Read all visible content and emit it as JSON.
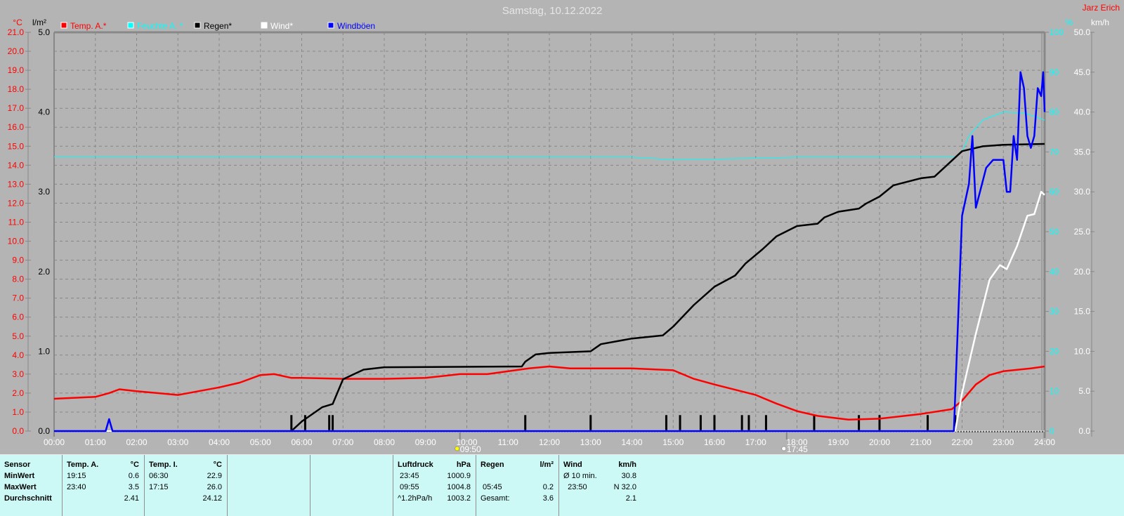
{
  "title": "Samstag, 10.12.2022",
  "author": "Jarz Erich",
  "colors": {
    "background": "#b4b4b4",
    "temp": "#ff0000",
    "humidity": "#00ffff",
    "rain": "#000000",
    "wind": "#ffffff",
    "gusts": "#0000ff",
    "table_bg": "#ccf9f6"
  },
  "markers": [
    {
      "time": "09:50",
      "label": "09:50",
      "icon": "sunrise-icon"
    },
    {
      "time": "17:45",
      "label": "17:45",
      "icon": "sunset-icon"
    }
  ],
  "chart_data": {
    "type": "line",
    "title": "Samstag, 10.12.2022",
    "grid": true,
    "legend_position": "top-left",
    "x_ticks": [
      "00:00",
      "01:00",
      "02:00",
      "03:00",
      "04:00",
      "05:00",
      "06:00",
      "07:00",
      "08:00",
      "09:00",
      "10:00",
      "11:00",
      "12:00",
      "13:00",
      "14:00",
      "15:00",
      "16:00",
      "17:00",
      "18:00",
      "19:00",
      "20:00",
      "21:00",
      "22:00",
      "23:00",
      "24:00"
    ],
    "axes": {
      "temp": {
        "unit": "°C",
        "range": [
          0,
          21
        ],
        "ticks": [
          "0.0",
          "1.0",
          "2.0",
          "3.0",
          "4.0",
          "5.0",
          "6.0",
          "7.0",
          "8.0",
          "9.0",
          "10.0",
          "11.0",
          "12.0",
          "13.0",
          "14.0",
          "15.0",
          "16.0",
          "17.0",
          "18.0",
          "19.0",
          "20.0",
          "21.0"
        ]
      },
      "rain": {
        "unit": "l/m²",
        "range": [
          0,
          5
        ],
        "ticks": [
          "0.0",
          "1.0",
          "2.0",
          "3.0",
          "4.0",
          "5.0"
        ]
      },
      "humidity": {
        "unit": "%",
        "range": [
          0,
          100
        ],
        "ticks": [
          "0",
          "10",
          "20",
          "30",
          "40",
          "50",
          "60",
          "70",
          "80",
          "90",
          "100"
        ]
      },
      "wind": {
        "unit": "km/h",
        "range": [
          0,
          50
        ],
        "ticks": [
          "0.0",
          "5.0",
          "10.0",
          "15.0",
          "20.0",
          "25.0",
          "30.0",
          "35.0",
          "40.0",
          "45.0",
          "50.0"
        ]
      }
    },
    "series": [
      {
        "name": "Temp. A.*",
        "axis": "temp",
        "color": "#ff0000",
        "points": [
          [
            "00:00",
            1.7
          ],
          [
            "01:00",
            1.8
          ],
          [
            "01:20",
            2.0
          ],
          [
            "01:35",
            2.2
          ],
          [
            "02:00",
            2.1
          ],
          [
            "02:30",
            2.0
          ],
          [
            "03:00",
            1.9
          ],
          [
            "04:00",
            2.3
          ],
          [
            "04:30",
            2.55
          ],
          [
            "05:00",
            2.95
          ],
          [
            "05:20",
            3.0
          ],
          [
            "05:45",
            2.8
          ],
          [
            "06:00",
            2.8
          ],
          [
            "07:00",
            2.75
          ],
          [
            "08:00",
            2.75
          ],
          [
            "09:00",
            2.8
          ],
          [
            "09:50",
            3.0
          ],
          [
            "10:30",
            3.0
          ],
          [
            "11:30",
            3.3
          ],
          [
            "12:00",
            3.4
          ],
          [
            "12:30",
            3.3
          ],
          [
            "14:00",
            3.3
          ],
          [
            "15:00",
            3.2
          ],
          [
            "15:30",
            2.75
          ],
          [
            "16:00",
            2.45
          ],
          [
            "17:00",
            1.9
          ],
          [
            "17:30",
            1.45
          ],
          [
            "18:00",
            1.05
          ],
          [
            "18:30",
            0.8
          ],
          [
            "19:15",
            0.6
          ],
          [
            "20:00",
            0.65
          ],
          [
            "21:00",
            0.9
          ],
          [
            "21:45",
            1.15
          ],
          [
            "22:00",
            1.6
          ],
          [
            "22:20",
            2.45
          ],
          [
            "22:40",
            2.95
          ],
          [
            "23:00",
            3.15
          ],
          [
            "23:40",
            3.3
          ],
          [
            "24:00",
            3.4
          ]
        ]
      },
      {
        "name": "Feuchte A. *",
        "axis": "humidity",
        "color": "#00ffff",
        "points": [
          [
            "00:00",
            68.7
          ],
          [
            "14:00",
            68.7
          ],
          [
            "15:00",
            68.0
          ],
          [
            "17:00",
            68.4
          ],
          [
            "18:00",
            68.7
          ],
          [
            "21:50",
            68.7
          ],
          [
            "22:00",
            70
          ],
          [
            "22:10",
            74
          ],
          [
            "22:30",
            78
          ],
          [
            "23:00",
            80
          ],
          [
            "23:30",
            79.8
          ],
          [
            "24:00",
            78
          ]
        ]
      },
      {
        "name": "Regen*",
        "axis": "rain",
        "color": "#000000",
        "points": [
          [
            "00:00",
            0
          ],
          [
            "05:45",
            0
          ],
          [
            "06:00",
            0.12
          ],
          [
            "06:30",
            0.3
          ],
          [
            "06:45",
            0.34
          ],
          [
            "07:00",
            0.65
          ],
          [
            "07:30",
            0.77
          ],
          [
            "08:00",
            0.8
          ],
          [
            "11:20",
            0.81
          ],
          [
            "11:25",
            0.87
          ],
          [
            "11:40",
            0.96
          ],
          [
            "12:00",
            0.98
          ],
          [
            "13:00",
            1.0
          ],
          [
            "13:15",
            1.09
          ],
          [
            "14:00",
            1.16
          ],
          [
            "14:45",
            1.2
          ],
          [
            "15:00",
            1.31
          ],
          [
            "15:30",
            1.58
          ],
          [
            "16:00",
            1.81
          ],
          [
            "16:30",
            1.95
          ],
          [
            "16:45",
            2.1
          ],
          [
            "17:10",
            2.28
          ],
          [
            "17:30",
            2.44
          ],
          [
            "18:00",
            2.57
          ],
          [
            "18:30",
            2.6
          ],
          [
            "18:40",
            2.68
          ],
          [
            "19:00",
            2.75
          ],
          [
            "19:30",
            2.79
          ],
          [
            "19:40",
            2.85
          ],
          [
            "20:00",
            2.94
          ],
          [
            "20:20",
            3.08
          ],
          [
            "21:00",
            3.17
          ],
          [
            "21:20",
            3.19
          ],
          [
            "21:40",
            3.35
          ],
          [
            "22:00",
            3.51
          ],
          [
            "22:30",
            3.57
          ],
          [
            "23:00",
            3.59
          ],
          [
            "24:00",
            3.6
          ]
        ]
      },
      {
        "name": "Wind*",
        "axis": "wind",
        "color": "#ffffff",
        "points": [
          [
            "00:00",
            0
          ],
          [
            "21:50",
            0
          ],
          [
            "22:00",
            4.8
          ],
          [
            "22:20",
            12.2
          ],
          [
            "22:40",
            19
          ],
          [
            "22:55",
            20.8
          ],
          [
            "23:05",
            20.3
          ],
          [
            "23:20",
            23.2
          ],
          [
            "23:35",
            27
          ],
          [
            "23:45",
            27.2
          ],
          [
            "23:55",
            30
          ],
          [
            "24:00",
            29.6
          ]
        ]
      },
      {
        "name": "Windböen",
        "axis": "wind",
        "color": "#0000ff",
        "points": [
          [
            "00:00",
            0
          ],
          [
            "01:15",
            0
          ],
          [
            "01:20",
            1.5
          ],
          [
            "01:25",
            0
          ],
          [
            "21:48",
            0
          ],
          [
            "22:00",
            27
          ],
          [
            "22:10",
            31
          ],
          [
            "22:15",
            37
          ],
          [
            "22:20",
            28
          ],
          [
            "22:35",
            33
          ],
          [
            "22:45",
            34
          ],
          [
            "23:00",
            34
          ],
          [
            "23:05",
            30
          ],
          [
            "23:10",
            30
          ],
          [
            "23:15",
            37
          ],
          [
            "23:20",
            34
          ],
          [
            "23:25",
            45
          ],
          [
            "23:30",
            43
          ],
          [
            "23:35",
            37
          ],
          [
            "23:40",
            35.5
          ],
          [
            "23:45",
            37
          ],
          [
            "23:50",
            43
          ],
          [
            "23:55",
            42
          ],
          [
            "23:58",
            45
          ],
          [
            "24:00",
            40
          ]
        ]
      }
    ],
    "rain_bars": {
      "axis": "rain",
      "color": "#000000",
      "bars": [
        [
          "05:45",
          0.2
        ],
        [
          "06:05",
          0.2
        ],
        [
          "06:40",
          0.2
        ],
        [
          "06:45",
          0.2
        ],
        [
          "11:25",
          0.2
        ],
        [
          "13:00",
          0.2
        ],
        [
          "14:50",
          0.2
        ],
        [
          "15:10",
          0.2
        ],
        [
          "15:40",
          0.2
        ],
        [
          "16:00",
          0.2
        ],
        [
          "16:40",
          0.2
        ],
        [
          "16:50",
          0.2
        ],
        [
          "17:15",
          0.2
        ],
        [
          "18:25",
          0.2
        ],
        [
          "19:30",
          0.2
        ],
        [
          "20:00",
          0.2
        ],
        [
          "21:10",
          0.2
        ],
        [
          "21:50",
          0.2
        ]
      ]
    }
  },
  "table": {
    "columns": [
      {
        "rows": [
          [
            "Sensor",
            ""
          ],
          [
            "MinWert",
            ""
          ],
          [
            "MaxWert",
            ""
          ],
          [
            "Durchschnitt",
            ""
          ]
        ]
      },
      {
        "rows": [
          [
            "Temp. A.",
            "°C"
          ],
          [
            "19:15",
            "0.6"
          ],
          [
            "23:40",
            "3.5"
          ],
          [
            "",
            "2.41"
          ]
        ]
      },
      {
        "rows": [
          [
            "Temp. I.",
            "°C"
          ],
          [
            "06:30",
            "22.9"
          ],
          [
            "17:15",
            "26.0"
          ],
          [
            "",
            "24.12"
          ]
        ]
      },
      {
        "rows": []
      },
      {
        "rows": []
      },
      {
        "rows": [
          [
            "Luftdruck",
            "hPa"
          ],
          [
            " 23:45",
            "1000.9"
          ],
          [
            " 09:55",
            "1004.8"
          ],
          [
            "^1.2hPa/h",
            "1003.2"
          ]
        ]
      },
      {
        "rows": [
          [
            "Regen",
            "l/m²"
          ],
          [
            "",
            ""
          ],
          [
            " 05:45",
            "0.2"
          ],
          [
            "Gesamt:",
            "3.6"
          ]
        ]
      },
      {
        "rows": [
          [
            "Wind",
            "km/h"
          ],
          [
            "Ø 10 min.",
            "30.8"
          ],
          [
            "  23:50",
            "N 32.0"
          ],
          [
            "",
            "2.1"
          ]
        ]
      }
    ]
  }
}
